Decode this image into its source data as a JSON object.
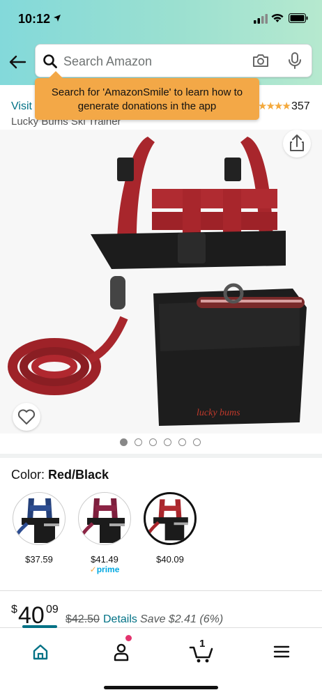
{
  "status_bar": {
    "time": "10:12"
  },
  "search": {
    "placeholder": "Search Amazon"
  },
  "tooltip": {
    "text": "Search for 'AmazonSmile' to learn how to generate donations in the app"
  },
  "product": {
    "visit_link": "Visit",
    "title": "Lucky Bums Ski Trainer",
    "rating_count": "357",
    "rating_stars": "★★★★"
  },
  "image_dots": {
    "count": 6,
    "active_index": 0
  },
  "color": {
    "label": "Color:",
    "selected": "Red/Black",
    "options": [
      {
        "name": "Blue/Black",
        "price": "$37.59",
        "prime": ""
      },
      {
        "name": "Maroon/Black",
        "price": "$41.49",
        "prime": "prime"
      },
      {
        "name": "Red/Black",
        "price": "$40.09",
        "prime": ""
      }
    ]
  },
  "price": {
    "symbol": "$",
    "dollars": "40",
    "cents": "09",
    "old": "$42.50",
    "details": "Details",
    "save": "Save $2.41 (6%)"
  },
  "nav": {
    "cart_count": "1",
    "items": [
      "home",
      "account",
      "cart",
      "menu"
    ]
  },
  "colors": {
    "accent": "#007185",
    "tooltip": "#f3a847",
    "strap_red": "#a8262c"
  }
}
